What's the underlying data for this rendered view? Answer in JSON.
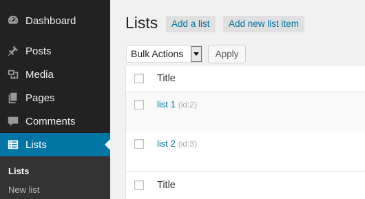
{
  "sidebar": {
    "items": [
      {
        "label": "Dashboard",
        "icon": "dashboard-icon"
      },
      {
        "label": "Posts",
        "icon": "pin-icon"
      },
      {
        "label": "Media",
        "icon": "media-icon"
      },
      {
        "label": "Pages",
        "icon": "pages-icon"
      },
      {
        "label": "Comments",
        "icon": "comment-icon"
      },
      {
        "label": "Lists",
        "icon": "list-icon",
        "active": true
      }
    ],
    "submenu": [
      {
        "label": "Lists",
        "current": true
      },
      {
        "label": "New list",
        "current": false
      }
    ]
  },
  "main": {
    "title": "Lists",
    "add_list_button": "Add a list",
    "add_item_button": "Add new list item",
    "bulk_actions": {
      "selected": "Bulk Actions"
    },
    "apply_button": "Apply",
    "table": {
      "header_title": "Title",
      "footer_title": "Title",
      "rows": [
        {
          "name": "list 1",
          "id": "(id:2)"
        },
        {
          "name": "list 2",
          "id": "(id:3)"
        }
      ]
    }
  },
  "colors": {
    "sidebar_bg": "#222222",
    "active_bg": "#0074a2",
    "link": "#0074a2",
    "page_bg": "#f1f1f1"
  }
}
